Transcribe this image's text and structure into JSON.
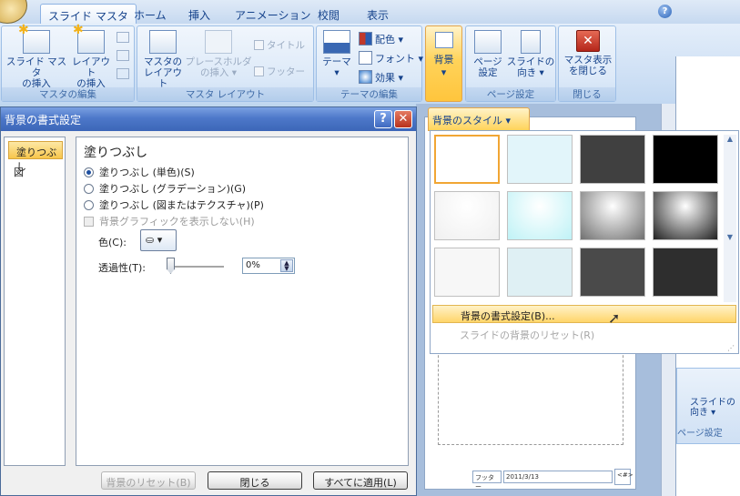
{
  "tabs": [
    {
      "label": "スライド マスタ",
      "active": true
    },
    {
      "label": "ホーム"
    },
    {
      "label": "挿入"
    },
    {
      "label": "アニメーション"
    },
    {
      "label": "校閲"
    },
    {
      "label": "表示"
    }
  ],
  "help_glyph": "?",
  "ribbon": {
    "master_edit": {
      "label": "マスタの編集",
      "insert_master": "スライド マスタ\nの挿入",
      "insert_layout": "レイアウト\nの挿入"
    },
    "master_layout": {
      "label": "マスタ レイアウト",
      "master_layout_btn": "マスタの\nレイアウト",
      "placeholder_btn": "プレースホルダ\nの挿入 ▾",
      "title_chk": "タイトル",
      "footer_chk": "フッター"
    },
    "theme_edit": {
      "label": "テーマの編集",
      "theme_btn": "テーマ\n▾",
      "colors": "配色 ▾",
      "fonts": "フォント ▾",
      "effects": "効果 ▾"
    },
    "background_btn": "背景\n▾",
    "page_setup": {
      "label": "ページ設定",
      "page_btn": "ページ\n設定",
      "orientation_btn": "スライドの\n向き ▾"
    },
    "close": {
      "label": "閉じる",
      "close_btn": "マスタ表示\nを閉じる"
    }
  },
  "dialog": {
    "title": "背景の書式設定",
    "help": "?",
    "close": "✕",
    "nav": [
      "塗りつぶし",
      "図"
    ],
    "section_title": "塗りつぶし",
    "options": [
      {
        "label": "塗りつぶし (単色)(S)",
        "selected": true
      },
      {
        "label": "塗りつぶし (グラデーション)(G)",
        "selected": false
      },
      {
        "label": "塗りつぶし (図またはテクスチャ)(P)",
        "selected": false
      }
    ],
    "hide_graphics": "背景グラフィックを表示しない(H)",
    "color_label": "色(C):",
    "transparency_label": "透過性(T):",
    "transparency_value": "0%",
    "transparency_fraction": 0,
    "reset_btn": "背景のリセット(B)",
    "close_btn": "閉じる",
    "apply_all_btn": "すべてに適用(L)"
  },
  "styles_dropdown": {
    "button": "背景のスタイル ▾",
    "menu": [
      {
        "label": "背景の書式設定(B)...",
        "enabled": true
      },
      {
        "label": "スライドの背景のリセット(R)",
        "enabled": false
      }
    ]
  },
  "swatches": [
    [
      "#ffffff",
      "#e2f5fa",
      "#404040",
      "#000000"
    ],
    [
      "#f0f0f0",
      "#bff2f6",
      "#707070",
      "#202020"
    ],
    [
      "#f7f7f7",
      "#dff0f4",
      "#4a4a4a",
      "#2e2e2e"
    ]
  ],
  "slide_footer": {
    "footer": "フッター",
    "date": "2011/3/13",
    "page": "<#>"
  },
  "right_ribbon": {
    "orientation": "スライドの\n向き ▾",
    "page_setup": "ページ設定"
  },
  "colors": {
    "accent": "#f8c64b",
    "title_bar": "#4d78c9",
    "ribbon_text": "#15428b"
  }
}
